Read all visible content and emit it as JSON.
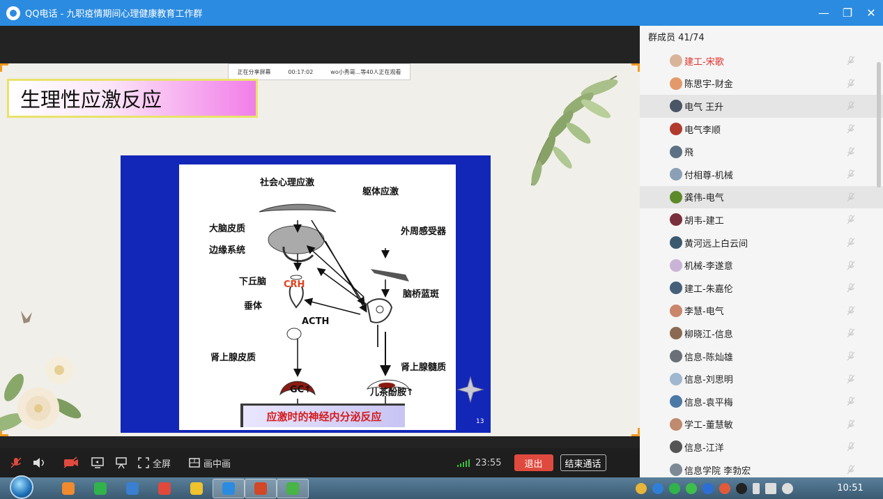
{
  "window": {
    "title": "QQ电话 - 九职疫情期间心理健康教育工作群",
    "minimize": "—",
    "restore": "❐",
    "close": "✕"
  },
  "share_banner": {
    "status": "正在分享屏幕",
    "duration": "00:17:02",
    "viewers": "wo小秀哥...等40人正在观看"
  },
  "slide": {
    "title": "生理性应激反应",
    "diagram_labels": {
      "social": "社会心理应激",
      "body": "躯体应激",
      "cortex": "大脑皮质",
      "peripheral": "外周感受器",
      "limbic": "边缘系统",
      "hypothalamus": "下丘脑",
      "crh": "CRH",
      "locus": "脑桥蓝斑",
      "pituitary": "垂体",
      "acth": "ACTH",
      "adrenal_cortex": "肾上腺皮质",
      "adrenal_medulla": "肾上腺髓质",
      "gc": "GC↑",
      "catecholamine": "儿茶酚胺↑"
    },
    "caption": "应激时的神经内分泌反应",
    "page_number": "13"
  },
  "controls": {
    "fullscreen": "全屏",
    "pip": "画中画",
    "call_time": "23:55",
    "exit": "退出",
    "end_call": "结束通话"
  },
  "members": {
    "header": "群成员 41/74",
    "list": [
      {
        "name": "建工-宋歌",
        "color": "#d8b49a"
      },
      {
        "name": "陈思宇-财金",
        "color": "#e39a6a"
      },
      {
        "name": "电气 王升",
        "color": "#4a5566"
      },
      {
        "name": "电气李顺",
        "color": "#b13a2e"
      },
      {
        "name": "飛",
        "color": "#5d7184"
      },
      {
        "name": "付相尊-机械",
        "color": "#8ba0b6"
      },
      {
        "name": "龚伟-电气",
        "color": "#5c8a2a"
      },
      {
        "name": "胡韦-建工",
        "color": "#7a2f3c"
      },
      {
        "name": "黄河远上白云间",
        "color": "#3c5a6e"
      },
      {
        "name": "机械-李遂意",
        "color": "#c9b4d6"
      },
      {
        "name": "建工-朱嘉伦",
        "color": "#46607a"
      },
      {
        "name": "李慧-电气",
        "color": "#c9866a"
      },
      {
        "name": "柳晓江-信息",
        "color": "#8a6a52"
      },
      {
        "name": "信息-陈灿雄",
        "color": "#6a6f78"
      },
      {
        "name": "信息-刘思明",
        "color": "#9fb7cf"
      },
      {
        "name": "信息-袁平梅",
        "color": "#4c78a6"
      },
      {
        "name": "学工-董慧敏",
        "color": "#c08a6e"
      },
      {
        "name": "信息-江洋",
        "color": "#555555"
      },
      {
        "name": "信息学院 李勃宏",
        "color": "#7d8a96"
      }
    ]
  },
  "taskbar": {
    "clock": "10:51",
    "apps": [
      {
        "name": "hao123",
        "color": "#f08a2e"
      },
      {
        "name": "wechat",
        "color": "#2fb34a"
      },
      {
        "name": "windows-explorer",
        "color": "#3a7fd0"
      },
      {
        "name": "chrome",
        "color": "#e0493b"
      },
      {
        "name": "media-player",
        "color": "#f0c22e"
      },
      {
        "name": "qq-call",
        "color": "#2b8be0"
      },
      {
        "name": "powerpoint",
        "color": "#d24726"
      },
      {
        "name": "360-browser",
        "color": "#47b445"
      }
    ]
  }
}
